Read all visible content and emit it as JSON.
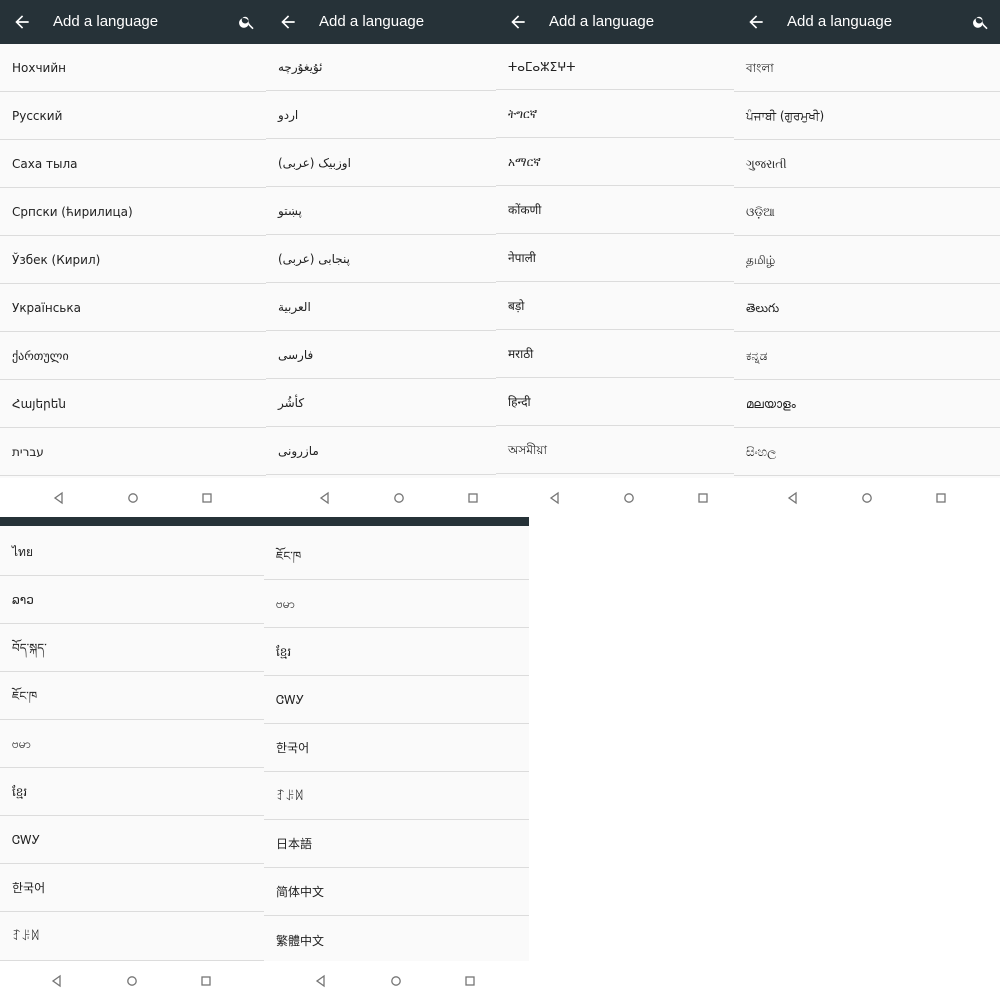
{
  "screens": [
    {
      "title": "Add a language",
      "languages": [
        "Нохчийн",
        "Русский",
        "Саха тыла",
        "Српски (ћирилица)",
        "Ўзбек (Кирил)",
        "Українська",
        "ქართული",
        "Հայերեն",
        "עברית"
      ]
    },
    {
      "title": "Add a language",
      "languages": [
        "ئۇيغۇرچە",
        "اردو",
        "اوزبیک (عربی)",
        "پښتو",
        "پنجابی (عربی)",
        "العربية",
        "فارسی",
        "کأشُر",
        "مازرونی"
      ]
    },
    {
      "title": "Add a language",
      "languages": [
        "ⵜⴰⵎⴰⵣⵉⵖⵜ",
        "ትግርኛ",
        "አማርኛ",
        "कोंकणी",
        "नेपाली",
        "बड़ो",
        "मराठी",
        "हिन्दी",
        "অসমীয়া"
      ]
    },
    {
      "title": "Add a language",
      "languages": [
        "বাংলা",
        "ਪੰਜਾਬੀ (ਗੁਰਮੁਖੀ)",
        "ગુજરાતી",
        "ଓଡ଼ିଆ",
        "தமிழ்",
        "తెలుగు",
        "ಕನ್ನಡ",
        "മലയാളം",
        "සිංහල"
      ]
    },
    {
      "languages": [
        "ไทย",
        "ລາວ",
        "བོད་སྐད་",
        "ཇོང་ཁ",
        "ဗမာ",
        "ខ្មែរ",
        "ᏣᎳᎩ",
        "한국어",
        "ꆈꌠꉙ"
      ]
    },
    {
      "languages": [
        "ཇོང་ཁ",
        "ဗမာ",
        "ខ្មែរ",
        "ᏣᎳᎩ",
        "한국어",
        "ꆈꌠꉙ",
        "日本語",
        "简体中文",
        "繁體中文"
      ]
    }
  ],
  "colors": {
    "appbar": "#263238",
    "list_background": "#fafafa",
    "divider": "#dcdcdc",
    "nav_icon": "#757575"
  },
  "icons": {
    "back": "arrow-back-icon",
    "search": "search-icon",
    "nav_back": "nav-back-icon",
    "nav_home": "nav-home-icon",
    "nav_recents": "nav-recents-icon"
  }
}
